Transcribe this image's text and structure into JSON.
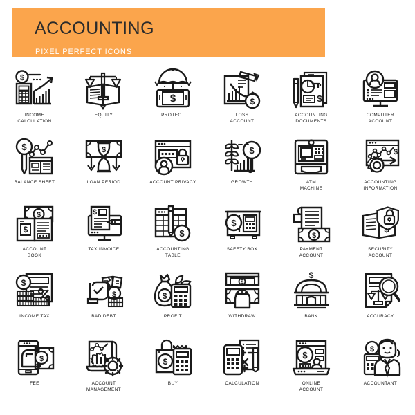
{
  "header": {
    "title": "ACCOUNTING",
    "subtitle": "PIXEL PERFECT ICONS",
    "background_color": "#FBA54C",
    "title_color": "#2B2B2B",
    "subtitle_color": "#FFFFFF",
    "rule_color": "#FFD9A8"
  },
  "grid": {
    "columns": 6,
    "rows": 5,
    "stroke_color": "#1B1B1B",
    "background_color": "#FFFFFF"
  },
  "icons": [
    {
      "id": "income-calculation",
      "label": "INCOME\nCALCULATION",
      "art": "calculator-chart-coin"
    },
    {
      "id": "equity",
      "label": "EQUITY",
      "art": "scales-book"
    },
    {
      "id": "protect",
      "label": "PROTECT",
      "art": "umbrella-phone-dollar"
    },
    {
      "id": "loss-account",
      "label": "LOSS\nACCOUNT",
      "art": "clipboard-down-arrow-coin"
    },
    {
      "id": "accounting-documents",
      "label": "ACCOUNTING\nDOCUMENTS",
      "art": "papers-pencil-piechart"
    },
    {
      "id": "computer-account",
      "label": "COMPUTER\nACCOUNT",
      "art": "monitor-user"
    },
    {
      "id": "balance-sheet",
      "label": "BALANCE SHEET",
      "art": "magnifier-dollar-graph-paper"
    },
    {
      "id": "loan-period",
      "label": "LOAN PERIOD",
      "art": "hourglass-banknote-arrows"
    },
    {
      "id": "account-privacy",
      "label": "ACCOUNT PRIVACY",
      "art": "browser-padlock-user"
    },
    {
      "id": "growth",
      "label": "GROWTH",
      "art": "plant-bars-magnifier-dollar"
    },
    {
      "id": "atm-machine",
      "label": "ATM\nMACHINE",
      "art": "atm-terminal"
    },
    {
      "id": "accounting-information",
      "label": "ACCOUNTING\nINFORMATION",
      "art": "browser-linechart-gear-arrow"
    },
    {
      "id": "account-book",
      "label": "ACCOUNT\nBOOK",
      "art": "open-book-banknote"
    },
    {
      "id": "tax-invoice",
      "label": "TAX INVOICE",
      "art": "monitor-invoice-pencil"
    },
    {
      "id": "accounting-table",
      "label": "ACCOUNTING\nTABLE",
      "art": "spreadsheet-pencil-coin"
    },
    {
      "id": "safety-box",
      "label": "SAFETY BOX",
      "art": "safe-coin"
    },
    {
      "id": "payment-account",
      "label": "PAYMENT\nACCOUNT",
      "art": "receipt-banknote"
    },
    {
      "id": "security-account",
      "label": "SECURITY\nACCOUNT",
      "art": "book-shield-padlock"
    },
    {
      "id": "income-tax",
      "label": "INCOME TAX",
      "art": "document-percent-coins"
    },
    {
      "id": "bad-debt",
      "label": "BAD DEBT",
      "art": "hand-torn-note-coins"
    },
    {
      "id": "profit",
      "label": "PROFIT",
      "art": "money-bag-leaf-calculator"
    },
    {
      "id": "withdraw",
      "label": "WITHDRAW",
      "art": "atm-slot-hand-cash"
    },
    {
      "id": "bank",
      "label": "BANK",
      "art": "bank-building-dollar"
    },
    {
      "id": "accuracy",
      "label": "ACCURACY",
      "art": "document-scales-magnifier"
    },
    {
      "id": "fee",
      "label": "FEE",
      "art": "phone-hand-coin-banknote"
    },
    {
      "id": "account-management",
      "label": "ACCOUNT\nMANAGEMENT",
      "art": "report-bars-gear"
    },
    {
      "id": "buy",
      "label": "BUY",
      "art": "shopping-bag-receipt-calculator"
    },
    {
      "id": "calculation",
      "label": "CALCULATION",
      "art": "calculator-pencil-mathsheet"
    },
    {
      "id": "online-account",
      "label": "ONLINE\nACCOUNT",
      "art": "laptop-profile-coin"
    },
    {
      "id": "accountant",
      "label": "ACCOUNTANT",
      "art": "woman-calculator-coin"
    }
  ]
}
